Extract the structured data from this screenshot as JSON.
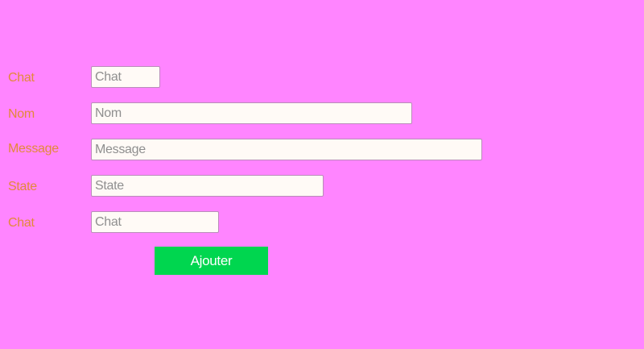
{
  "form": {
    "fields": [
      {
        "label": "Chat",
        "placeholder": "Chat",
        "value": ""
      },
      {
        "label": "Nom",
        "placeholder": "Nom",
        "value": ""
      },
      {
        "label": "Message",
        "placeholder": "Message",
        "value": ""
      },
      {
        "label": "State",
        "placeholder": "State",
        "value": ""
      },
      {
        "label": "Chat",
        "placeholder": "Chat",
        "value": ""
      }
    ],
    "submit_label": "Ajouter"
  },
  "colors": {
    "background": "#ff85ff",
    "label_text": "#e3883a",
    "input_background": "#fffaf6",
    "button_background": "#00d64f",
    "button_text": "#ffffff"
  }
}
